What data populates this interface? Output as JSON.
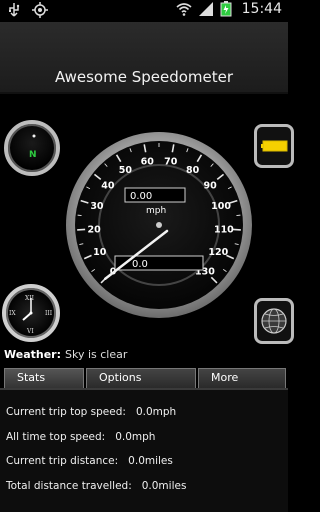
{
  "status_bar": {
    "time": "15:44",
    "icons": [
      "usb-icon",
      "gps-icon",
      "wifi-icon",
      "signal-icon",
      "battery-icon"
    ]
  },
  "app": {
    "title": "Awesome Speedometer"
  },
  "speedometer": {
    "unit": "mph",
    "speed_readout": "0.00",
    "odometer_readout": "0.0",
    "scale_min": 0,
    "scale_max": 130,
    "tick_labels": [
      "0",
      "10",
      "20",
      "30",
      "40",
      "50",
      "60",
      "70",
      "80",
      "90",
      "100",
      "110",
      "120",
      "130"
    ],
    "current_speed": 0,
    "needle_color": "#f2f2f2",
    "accent": "#f5d000"
  },
  "compass": {
    "heading_label": "N",
    "heading_color": "#2ecc40"
  },
  "clock": {
    "numerals": [
      "XII",
      "III",
      "VI",
      "IX"
    ]
  },
  "weather": {
    "label": "Weather:",
    "value": "Sky is clear"
  },
  "tabs": [
    {
      "label": "Stats",
      "active": true
    },
    {
      "label": "Options",
      "active": false
    },
    {
      "label": "More",
      "active": false
    }
  ],
  "stats": {
    "current_trip_top_speed": {
      "label": "Current trip top speed:",
      "value": "0.0mph"
    },
    "all_time_top_speed": {
      "label": "All time top speed:",
      "value": "0.0mph"
    },
    "current_trip_distance": {
      "label": "Current trip distance:",
      "value": "0.0miles"
    },
    "total_distance": {
      "label": "Total distance travelled:",
      "value": "0.0miles"
    }
  }
}
